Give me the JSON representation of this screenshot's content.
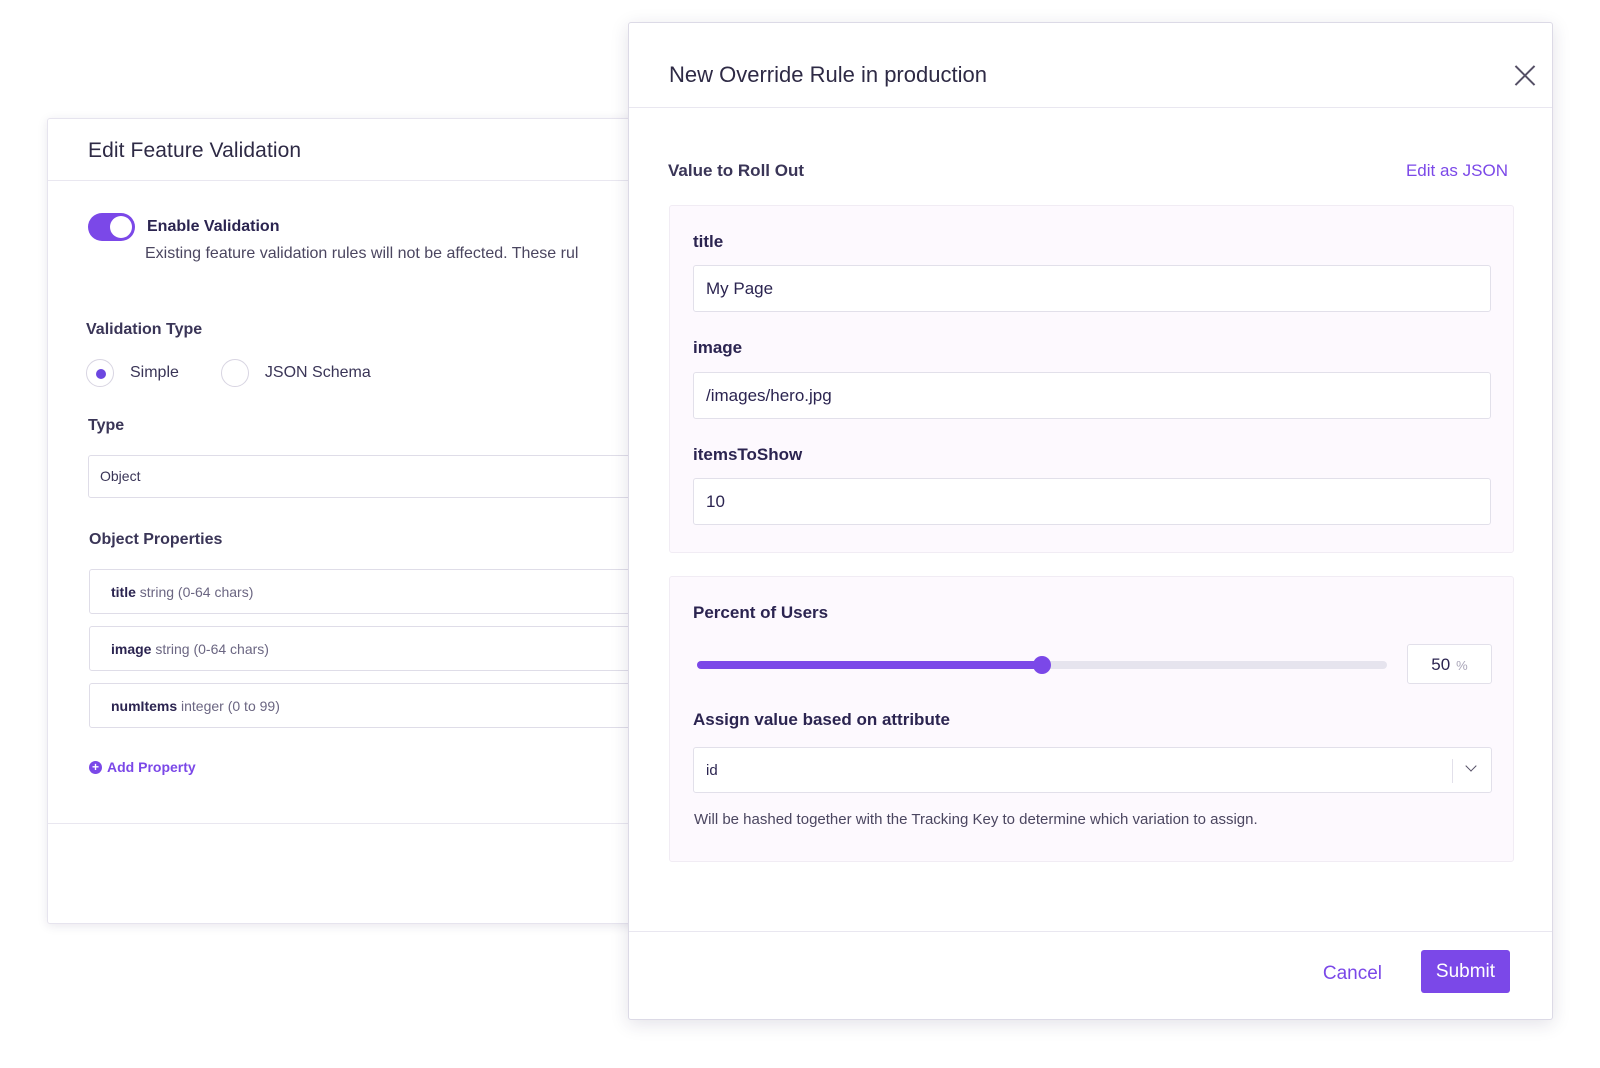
{
  "background_panel": {
    "title": "Edit Feature Validation",
    "toggle_label": "Enable Validation",
    "toggle_help": "Existing feature validation rules will not be affected. These rul",
    "validation_type_label": "Validation Type",
    "radio_simple": "Simple",
    "radio_json_schema": "JSON Schema",
    "type_label": "Type",
    "type_value": "Object",
    "object_properties_label": "Object Properties",
    "properties": [
      {
        "name": "title",
        "desc": "string (0-64 chars)"
      },
      {
        "name": "image",
        "desc": "string (0-64 chars)"
      },
      {
        "name": "numItems",
        "desc": "integer (0 to 99)"
      }
    ],
    "add_property": "Add Property"
  },
  "modal": {
    "title": "New Override Rule in production",
    "value_label": "Value to Roll Out",
    "edit_json": "Edit as JSON",
    "fields": [
      {
        "label": "title",
        "value": "My Page"
      },
      {
        "label": "image",
        "value": "/images/hero.jpg"
      },
      {
        "label": "itemsToShow",
        "value": "10"
      }
    ],
    "percent_label": "Percent of Users",
    "percent_value": "50",
    "percent_unit": "%",
    "percent_fraction": 0.5,
    "assign_label": "Assign value based on attribute",
    "assign_value": "id",
    "assign_hint": "Will be hashed together with the Tracking Key to determine which variation to assign.",
    "cancel": "Cancel",
    "submit": "Submit"
  },
  "colors": {
    "accent": "#7b48e8",
    "text": "#2b2450"
  }
}
